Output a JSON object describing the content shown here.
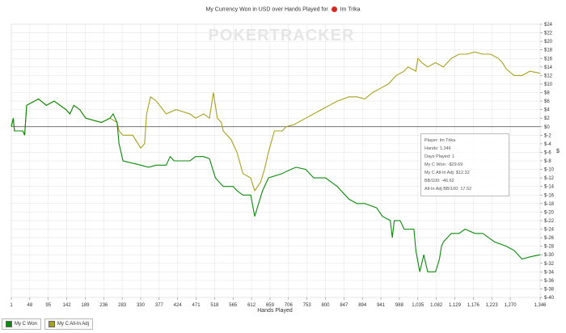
{
  "chart_title": {
    "prefix": "My Currency Won in USD over Hands Played for",
    "player": "Im Trika"
  },
  "watermark": "POKERTRACKER",
  "y_axis_unit": "$",
  "info_box": [
    "Player: Im Trika",
    "Hands: 1,346",
    "Days Played: 1",
    "My C Won: -$29.69",
    "My C All-In Adj: $12.32",
    "BB/100: -46.62",
    "All-In Adj BB/100: 17.52"
  ],
  "colors": {
    "won": "#0a8a0a",
    "allin": "#a7a21c",
    "zero_line": "#444444",
    "grid": "#e6e6e6"
  },
  "chart_data": {
    "type": "line",
    "title": "My Currency Won in USD over Hands Played for Im Trika",
    "xlabel": "Hands Played",
    "ylabel": "",
    "xlim": [
      1,
      1346
    ],
    "ylim": [
      -40,
      24
    ],
    "x_ticks": [
      1,
      48,
      95,
      142,
      189,
      236,
      283,
      330,
      377,
      424,
      471,
      518,
      565,
      612,
      659,
      706,
      753,
      800,
      847,
      894,
      941,
      988,
      1035,
      1082,
      1129,
      1176,
      1223,
      1270,
      1346
    ],
    "x_tick_labels": [
      "1",
      "48",
      "95",
      "142",
      "189",
      "236",
      "283",
      "330",
      "377",
      "424",
      "471",
      "518",
      "565",
      "612",
      "659",
      "706",
      "753",
      "800",
      "847",
      "894",
      "941",
      "988",
      "1,035",
      "1,082",
      "1,129",
      "1,176",
      "1,223",
      "1,270",
      "1,346"
    ],
    "y_ticks": [
      24,
      22,
      20,
      18,
      16,
      14,
      12,
      10,
      8,
      6,
      4,
      2,
      0,
      -2,
      -4,
      -6,
      -8,
      -10,
      -12,
      -14,
      -16,
      -18,
      -20,
      -22,
      -24,
      -26,
      -28,
      -30,
      -32,
      -34,
      -36,
      -38,
      -40
    ],
    "y_tick_labels": [
      "$24",
      "$22",
      "$20",
      "$18",
      "$16",
      "$14",
      "$12",
      "$10",
      "$8",
      "$6",
      "$4",
      "$2",
      "$0",
      "$-2",
      "$-4",
      "$-6",
      "$-8",
      "$-10",
      "$-12",
      "$-14",
      "$-16",
      "$-18",
      "$-20",
      "$-22",
      "$-24",
      "$-26",
      "$-28",
      "$-30",
      "$-32",
      "$-34",
      "$-36",
      "$-38",
      "$-40"
    ],
    "grid": true,
    "legend_position": "bottom-left",
    "series": [
      {
        "name": "My C Won",
        "points": [
          [
            1,
            0
          ],
          [
            6,
            2
          ],
          [
            9,
            -1
          ],
          [
            30,
            -1
          ],
          [
            35,
            -2
          ],
          [
            40,
            5
          ],
          [
            70,
            6.5
          ],
          [
            90,
            5
          ],
          [
            110,
            6
          ],
          [
            140,
            4
          ],
          [
            150,
            3
          ],
          [
            160,
            5
          ],
          [
            175,
            4
          ],
          [
            190,
            2
          ],
          [
            230,
            1
          ],
          [
            252,
            2
          ],
          [
            260,
            3
          ],
          [
            270,
            1
          ],
          [
            275,
            -4
          ],
          [
            280,
            -6
          ],
          [
            285,
            -8
          ],
          [
            330,
            -9
          ],
          [
            350,
            -9.5
          ],
          [
            370,
            -9
          ],
          [
            395,
            -9
          ],
          [
            405,
            -7
          ],
          [
            415,
            -8
          ],
          [
            455,
            -8
          ],
          [
            470,
            -7
          ],
          [
            490,
            -7
          ],
          [
            505,
            -7.5
          ],
          [
            510,
            -9
          ],
          [
            520,
            -12
          ],
          [
            540,
            -14
          ],
          [
            565,
            -14
          ],
          [
            575,
            -15
          ],
          [
            590,
            -16
          ],
          [
            610,
            -16
          ],
          [
            620,
            -21
          ],
          [
            630,
            -18
          ],
          [
            640,
            -15
          ],
          [
            655,
            -12
          ],
          [
            690,
            -11
          ],
          [
            700,
            -10.5
          ],
          [
            725,
            -9.5
          ],
          [
            750,
            -10
          ],
          [
            770,
            -12
          ],
          [
            790,
            -12
          ],
          [
            800,
            -12
          ],
          [
            830,
            -14
          ],
          [
            860,
            -17
          ],
          [
            880,
            -18
          ],
          [
            900,
            -18
          ],
          [
            930,
            -19
          ],
          [
            945,
            -21
          ],
          [
            965,
            -22
          ],
          [
            970,
            -26
          ],
          [
            975,
            -22
          ],
          [
            990,
            -22
          ],
          [
            1000,
            -24
          ],
          [
            1025,
            -24
          ],
          [
            1030,
            -29
          ],
          [
            1040,
            -34
          ],
          [
            1050,
            -30
          ],
          [
            1060,
            -34
          ],
          [
            1080,
            -34
          ],
          [
            1090,
            -31
          ],
          [
            1095,
            -28
          ],
          [
            1100,
            -27
          ],
          [
            1120,
            -25
          ],
          [
            1140,
            -25
          ],
          [
            1155,
            -24
          ],
          [
            1180,
            -25
          ],
          [
            1200,
            -25
          ],
          [
            1230,
            -27
          ],
          [
            1260,
            -28
          ],
          [
            1280,
            -29
          ],
          [
            1300,
            -31
          ],
          [
            1320,
            -30.5
          ],
          [
            1346,
            -30
          ]
        ]
      },
      {
        "name": "My C All-In Adj",
        "points": [
          [
            1,
            0
          ],
          [
            6,
            2
          ],
          [
            9,
            -1
          ],
          [
            30,
            -1
          ],
          [
            35,
            -2
          ],
          [
            40,
            5
          ],
          [
            70,
            6.5
          ],
          [
            90,
            5
          ],
          [
            110,
            6
          ],
          [
            140,
            4
          ],
          [
            150,
            3
          ],
          [
            160,
            5
          ],
          [
            175,
            4
          ],
          [
            190,
            2
          ],
          [
            230,
            1
          ],
          [
            252,
            2
          ],
          [
            270,
            1
          ],
          [
            275,
            -1
          ],
          [
            285,
            -2
          ],
          [
            310,
            -2
          ],
          [
            330,
            -5
          ],
          [
            340,
            -4
          ],
          [
            345,
            3
          ],
          [
            355,
            7
          ],
          [
            370,
            6
          ],
          [
            395,
            3
          ],
          [
            420,
            4
          ],
          [
            455,
            3
          ],
          [
            470,
            2
          ],
          [
            490,
            3
          ],
          [
            505,
            2
          ],
          [
            510,
            5
          ],
          [
            515,
            8
          ],
          [
            525,
            2
          ],
          [
            535,
            1
          ],
          [
            540,
            -1
          ],
          [
            560,
            -3
          ],
          [
            575,
            -6
          ],
          [
            590,
            -11
          ],
          [
            610,
            -12
          ],
          [
            620,
            -15
          ],
          [
            635,
            -13
          ],
          [
            645,
            -10
          ],
          [
            655,
            -6
          ],
          [
            670,
            -1
          ],
          [
            690,
            -1
          ],
          [
            700,
            0
          ],
          [
            720,
            0.5
          ],
          [
            750,
            2
          ],
          [
            770,
            3
          ],
          [
            790,
            4
          ],
          [
            810,
            5
          ],
          [
            830,
            6
          ],
          [
            860,
            7
          ],
          [
            880,
            7
          ],
          [
            900,
            6.5
          ],
          [
            920,
            8
          ],
          [
            940,
            9
          ],
          [
            960,
            10
          ],
          [
            980,
            12
          ],
          [
            1000,
            13
          ],
          [
            1010,
            14
          ],
          [
            1030,
            13
          ],
          [
            1035,
            16
          ],
          [
            1045,
            15
          ],
          [
            1060,
            14
          ],
          [
            1080,
            15
          ],
          [
            1100,
            14
          ],
          [
            1120,
            16
          ],
          [
            1140,
            17
          ],
          [
            1160,
            17
          ],
          [
            1180,
            17.5
          ],
          [
            1200,
            17
          ],
          [
            1220,
            17
          ],
          [
            1240,
            16
          ],
          [
            1250,
            15
          ],
          [
            1260,
            13.5
          ],
          [
            1280,
            12
          ],
          [
            1300,
            12
          ],
          [
            1320,
            13
          ],
          [
            1346,
            12.5
          ]
        ]
      }
    ]
  }
}
